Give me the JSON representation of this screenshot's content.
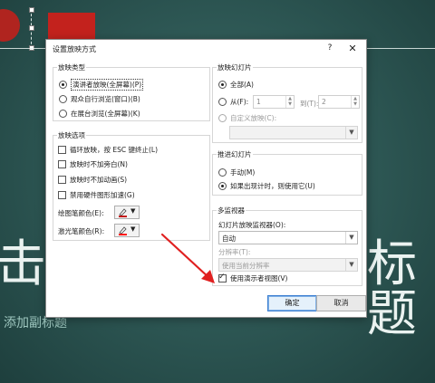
{
  "slide": {
    "title_left": "击",
    "title_right": "标题",
    "subtitle": "添加副标题"
  },
  "dialog": {
    "title": "设置放映方式",
    "help": "?",
    "close": "✕",
    "show_type": {
      "label": "放映类型",
      "options": [
        "演讲者放映(全屏幕)(P)",
        "观众自行浏览(窗口)(B)",
        "在展台浏览(全屏幕)(K)"
      ],
      "selected": 0
    },
    "show_options": {
      "label": "放映选项",
      "checks": [
        {
          "label": "循环放映，按 ESC 键终止(L)",
          "checked": false
        },
        {
          "label": "放映时不加旁白(N)",
          "checked": false
        },
        {
          "label": "放映时不加动画(S)",
          "checked": false
        },
        {
          "label": "禁用硬件图形加速(G)",
          "checked": false
        }
      ],
      "pen_color_label": "绘图笔颜色(E):",
      "laser_color_label": "激光笔颜色(R):",
      "pen_color": "#c00000",
      "laser_color": "#ff0000"
    },
    "show_slides": {
      "label": "放映幻灯片",
      "all_label": "全部(A)",
      "from_label": "从(F):",
      "from_value": "1",
      "to_label": "到(T):",
      "to_value": "2",
      "custom_label": "自定义放映(C):",
      "custom_value": ""
    },
    "advance": {
      "label": "推进幻灯片",
      "manual_label": "手动(M)",
      "timings_label": "如果出现计时，则使用它(U)",
      "selected": 1
    },
    "monitors": {
      "label": "多监视器",
      "monitor_label": "幻灯片放映监视器(O):",
      "monitor_value": "自动",
      "resolution_label": "分辨率(T):",
      "resolution_value": "使用当前分辨率",
      "presenter_view_label": "使用演示者视图(V)",
      "presenter_view_checked": true
    },
    "ok_label": "确定",
    "cancel_label": "取消"
  },
  "colors": {
    "slide_bg": "#2c5552",
    "accent_red": "#c3221d",
    "arrow_red": "#e02020",
    "default_button_border": "#3c7fd1"
  }
}
